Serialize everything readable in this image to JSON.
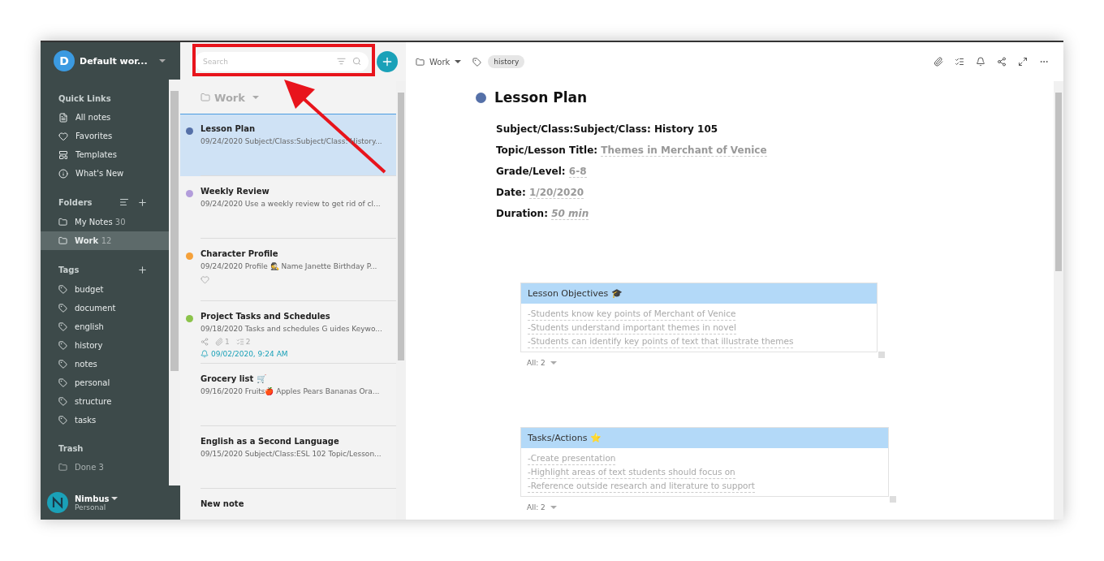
{
  "workspace": {
    "initial": "D",
    "name": "Default wor..."
  },
  "quick_links": {
    "title": "Quick Links",
    "items": [
      {
        "label": "All notes",
        "kind": "notes"
      },
      {
        "label": "Favorites",
        "kind": "favorites"
      },
      {
        "label": "Templates",
        "kind": "templates"
      },
      {
        "label": "What's New",
        "kind": "info"
      }
    ]
  },
  "folders": {
    "title": "Folders",
    "items": [
      {
        "label": "My Notes",
        "count": "30",
        "selected": false
      },
      {
        "label": "Work",
        "count": "12",
        "selected": true
      }
    ]
  },
  "tags": {
    "title": "Tags",
    "items": [
      "budget",
      "document",
      "english",
      "history",
      "notes",
      "personal",
      "structure",
      "tasks"
    ]
  },
  "trash": {
    "title": "Trash",
    "items": [
      {
        "label": "Done",
        "count": "3"
      }
    ]
  },
  "account": {
    "name": "Nimbus",
    "plan": "Personal"
  },
  "search": {
    "placeholder": "Search"
  },
  "list_header": {
    "folder": "Work"
  },
  "notes": [
    {
      "title": "Lesson Plan",
      "preview": "09/24/2020 Subject/Class:Subject/Class: History...",
      "color": "#5570a8",
      "selected": true
    },
    {
      "title": "Weekly Review",
      "preview": "09/24/2020 Use a weekly review to get rid of cl...",
      "color": "#b39ddb",
      "selected": false
    },
    {
      "title": "Character Profile",
      "preview": "09/24/2020 Profile 🕵 Name Janette Birthday P...",
      "color": "#f5a13a",
      "selected": false,
      "favorite_icon": true
    },
    {
      "title": "Project Tasks and Schedules",
      "preview": "09/18/2020 Tasks and schedules G uides Keywo...",
      "color": "#8bc34a",
      "selected": false,
      "shared": true,
      "attachments": "1",
      "checklists": "2",
      "reminder": "09/02/2020, 9:24 AM"
    },
    {
      "title": "Grocery list 🛒",
      "preview": "09/16/2020 Fruits🍎 Apples Pears Bananas Ora...",
      "selected": false
    },
    {
      "title": "English as a Second Language",
      "preview": "09/15/2020 Subject/Class:ESL 102 Topic/Lesson...",
      "selected": false
    },
    {
      "title": "New note",
      "selected": false
    }
  ],
  "editor": {
    "folder": "Work",
    "tag": "history",
    "title": "Lesson Plan",
    "color": "#5570a8",
    "fields": [
      {
        "label": "Subject/Class:Subject/Class:",
        "value": "History 105",
        "kind": "plain"
      },
      {
        "label": "Topic/Lesson Title:",
        "value": "Themes in Merchant of Venice",
        "kind": "link"
      },
      {
        "label": "Grade/Level:",
        "value": "6-8",
        "kind": "link"
      },
      {
        "label": "Date:",
        "value": "1/20/2020",
        "kind": "link"
      },
      {
        "label": "Duration:",
        "value": "50 min",
        "kind": "italic"
      }
    ],
    "tables": [
      {
        "title": "Lesson Objectives 🎓",
        "rows": [
          "-Students know key points of Merchant of Venice",
          "-Students understand important themes in novel",
          "-Students can identify key points of text that illustrate themes"
        ],
        "footer": "All: 2"
      },
      {
        "title": "Tasks/Actions ⭐",
        "rows": [
          "-Create presentation",
          "-Highlight areas of text students should focus on",
          "-Reference outside research and literature to support"
        ],
        "footer": "All: 2"
      }
    ]
  }
}
